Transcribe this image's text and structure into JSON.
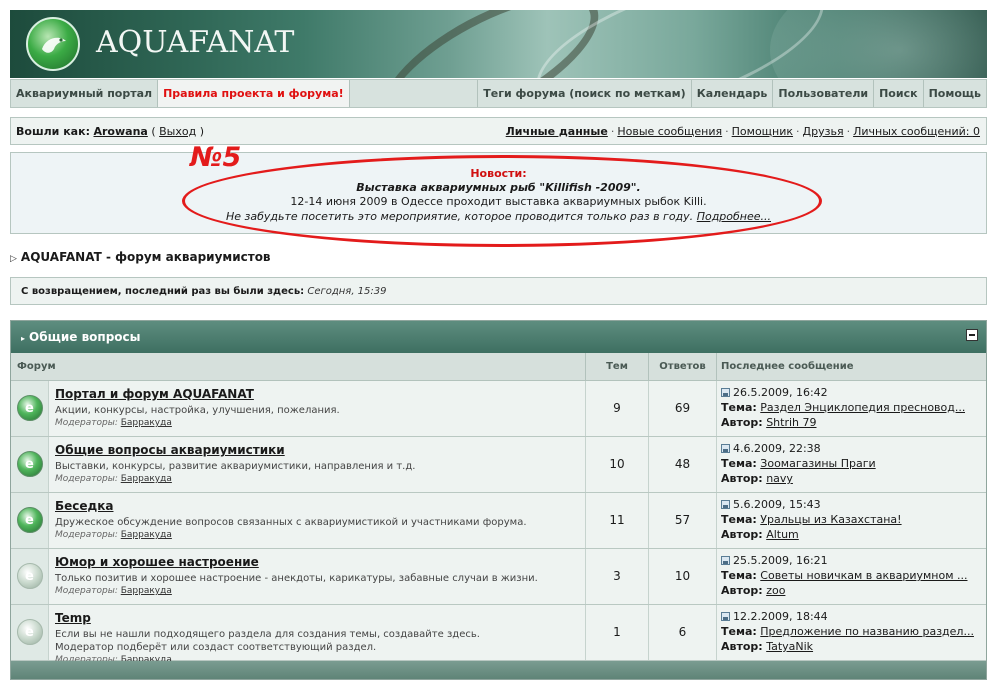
{
  "logo": {
    "text": "AQUAFANAT"
  },
  "nav": {
    "portal": "Аквариумный портал",
    "rules": "Правила проекта и форума!",
    "tags": "Теги форума (поиск по меткам)",
    "calendar": "Календарь",
    "users": "Пользователи",
    "search": "Поиск",
    "help": "Помощь"
  },
  "userbar": {
    "logged_as": "Вошли как:",
    "username": "Arowana",
    "logout": "Выход",
    "links": [
      "Личные данные",
      "Новые сообщения",
      "Помощник",
      "Друзья",
      "Личных сообщений: 0"
    ]
  },
  "news": {
    "title": "Новости:",
    "event": "Выставка аквариумных рыб \"Killifish -2009\".",
    "line1": "12-14 июня 2009 в Одессе проходит выставка аквариумных рыбок Killi.",
    "line2": "Не забудьте посетить это мероприятие, которое проводится только раз в году.",
    "more": "Подробнее..."
  },
  "annotation": "№5",
  "breadcrumb": "AQUAFANAT - форум аквариумистов",
  "welcome": {
    "label": "С возвращением, последний раз вы были здесь:",
    "time": "Сегодня, 15:39"
  },
  "category": {
    "title": "Общие вопросы",
    "columns": {
      "forum": "Форум",
      "topics": "Тем",
      "replies": "Ответов",
      "last": "Последнее сообщение"
    },
    "labels": {
      "moderators": "Модераторы:",
      "topic": "Тема:",
      "author": "Автор:"
    },
    "forums": [
      {
        "name": "Портал и форум AQUAFANAT",
        "desc": "Акции, конкурсы, настройка, улучшения, пожелания.",
        "desc2": "",
        "moderator": "Барракуда",
        "topics": "9",
        "replies": "69",
        "last_date": "26.5.2009, 16:42",
        "last_topic": "Раздел Энциклопедия пресновод...",
        "last_author": "Shtrih 79",
        "is_new": true
      },
      {
        "name": "Общие вопросы аквариумистики",
        "desc": "Выставки, конкурсы, развитие аквариумистики, направления и т.д.",
        "desc2": "",
        "moderator": "Барракуда",
        "topics": "10",
        "replies": "48",
        "last_date": "4.6.2009, 22:38",
        "last_topic": "Зоомагазины Праги",
        "last_author": "navy",
        "is_new": true
      },
      {
        "name": "Беседка",
        "desc": "Дружеское обсуждение вопросов связанных с аквариумистикой и участниками форума.",
        "desc2": "",
        "moderator": "Барракуда",
        "topics": "11",
        "replies": "57",
        "last_date": "5.6.2009, 15:43",
        "last_topic": "Уральцы из Казахстана!",
        "last_author": "Altum",
        "is_new": true
      },
      {
        "name": "Юмор и хорошее настроение",
        "desc": "Только позитив и хорошее настроение - анекдоты, карикатуры, забавные случаи в жизни.",
        "desc2": "",
        "moderator": "Барракуда",
        "topics": "3",
        "replies": "10",
        "last_date": "25.5.2009, 16:21",
        "last_topic": "Советы новичкам в аквариумном ...",
        "last_author": "zoo",
        "is_new": false
      },
      {
        "name": "Temp",
        "desc": "Если вы не нашли подходящего раздела для создания темы, создавайте здесь.",
        "desc2": "Модератор подберёт или создаст соответствующий раздел.",
        "moderator": "Барракуда",
        "topics": "1",
        "replies": "6",
        "last_date": "12.2.2009, 18:44",
        "last_topic": "Предложение по названию раздел...",
        "last_author": "TatyaNik",
        "is_new": false
      }
    ]
  },
  "colors": {
    "accent": "#3e6f61",
    "rules_link": "#e01010",
    "annotation": "#e31b1b"
  }
}
